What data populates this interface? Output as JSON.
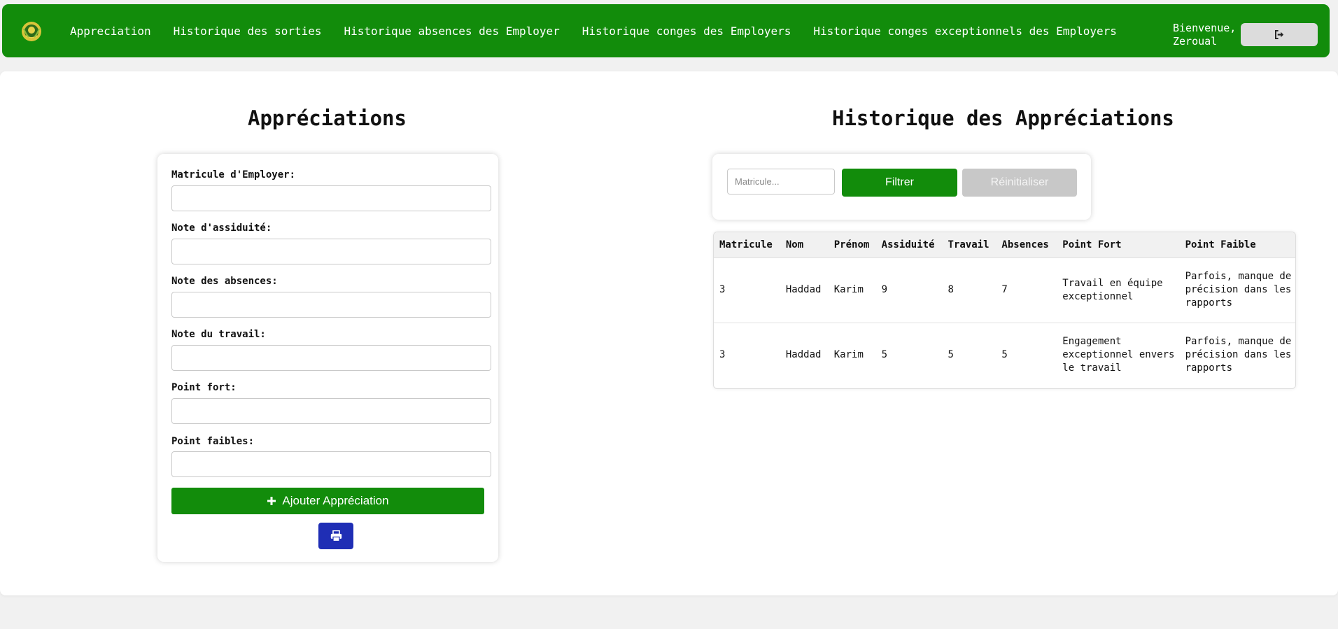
{
  "nav": {
    "links": [
      "Appreciation",
      "Historique des sorties",
      "Historique absences des Employer",
      "Historique conges des Employers",
      "Historique conges exceptionnels des Employers"
    ],
    "welcome_line1": "Bienvenue,",
    "welcome_line2": "Zeroual",
    "logout_icon": "sign-out-icon"
  },
  "form": {
    "title": "Appréciations",
    "fields": [
      {
        "label": "Matricule d'Employer:",
        "value": ""
      },
      {
        "label": "Note d'assiduité:",
        "value": ""
      },
      {
        "label": "Note des absences:",
        "value": ""
      },
      {
        "label": "Note du travail:",
        "value": ""
      },
      {
        "label": "Point fort:",
        "value": ""
      },
      {
        "label": "Point faibles:",
        "value": ""
      }
    ],
    "add_button": "Ajouter Appréciation",
    "print_icon": "print-icon"
  },
  "history": {
    "title": "Historique des Appréciations",
    "filter_placeholder": "Matricule...",
    "filter_button": "Filtrer",
    "reset_button": "Réinitialiser",
    "columns": [
      "Matricule",
      "Nom",
      "Prénom",
      "Assiduité",
      "Travail",
      "Absences",
      "Point Fort",
      "Point Faible"
    ],
    "rows": [
      [
        "3",
        "Haddad",
        "Karim",
        "9",
        "8",
        "7",
        "Travail en équipe exceptionnel",
        "Parfois, manque de précision dans les rapports"
      ],
      [
        "3",
        "Haddad",
        "Karim",
        "5",
        "5",
        "5",
        "Engagement exceptionnel envers le travail",
        "Parfois, manque de précision dans les rapports"
      ]
    ]
  },
  "colors": {
    "primary_green": "#128c0b",
    "print_blue": "#1f2eb5",
    "reset_gray": "#c8c8c8"
  }
}
